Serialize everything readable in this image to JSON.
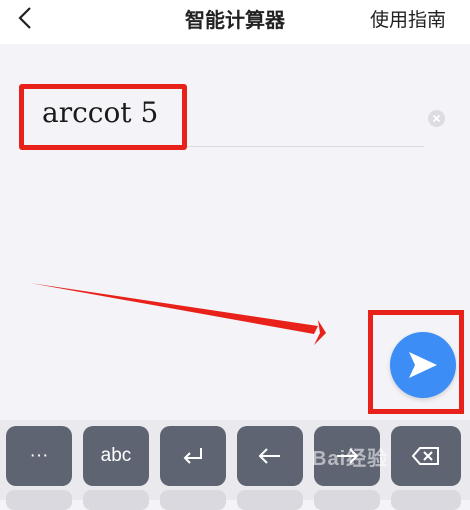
{
  "header": {
    "title": "智能计算器",
    "guide_label": "使用指南"
  },
  "input": {
    "expression": "arccot 5"
  },
  "keyboard": {
    "keys": [
      "···",
      "abc"
    ]
  },
  "watermark": "Bai经验",
  "colors": {
    "accent": "#3d8df7",
    "highlight": "#e8221b",
    "key_bg": "#5f6472"
  }
}
